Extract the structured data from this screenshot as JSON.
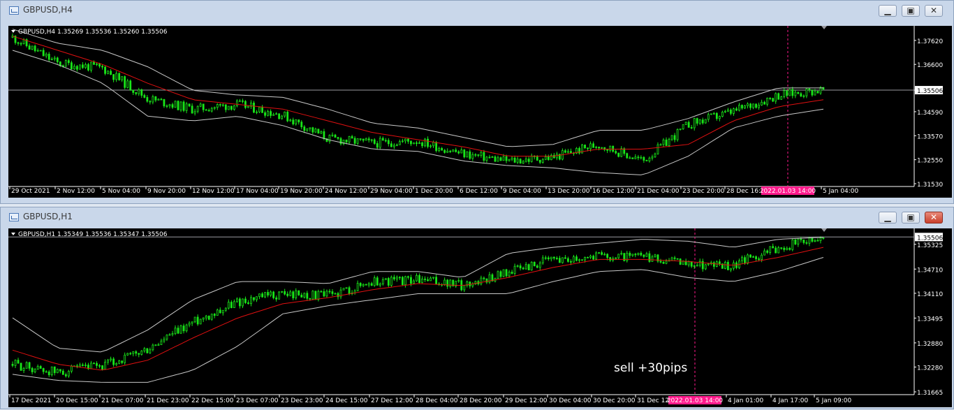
{
  "windows": [
    {
      "title": "GBPUSD,H4",
      "info": "GBPUSD,H4  1.35269 1.35536 1.35260 1.35506",
      "price_labels": [
        "1.37620",
        "1.36600",
        "1.35506",
        "1.34590",
        "1.33570",
        "1.32550",
        "1.31530"
      ],
      "current_price": "1.35506",
      "time_labels": [
        "29 Oct 2021",
        "2 Nov 12:00",
        "5 Nov 04:00",
        "9 Nov 20:00",
        "12 Nov 12:00",
        "17 Nov 04:00",
        "19 Nov 20:00",
        "24 Nov 12:00",
        "29 Nov 04:00",
        "1 Dec 20:00",
        "6 Dec 12:00",
        "9 Dec 04:00",
        "13 Dec 20:00",
        "16 Dec 12:00",
        "21 Dec 04:00",
        "23 Dec 20:00",
        "28 Dec 16:00",
        "5 Jan 04:00"
      ],
      "highlight_time": "2022.01.03 14:00",
      "close_button_style": "normal"
    },
    {
      "title": "GBPUSD,H1",
      "info": "GBPUSD,H1  1.35349 1.35536 1.35347 1.35506",
      "price_labels": [
        "1.35325",
        "1.34710",
        "1.34110",
        "1.33495",
        "1.32880",
        "1.32280",
        "1.31665"
      ],
      "current_price": "1.35506",
      "time_labels": [
        "17 Dec 2021",
        "20 Dec 15:00",
        "21 Dec 07:00",
        "21 Dec 23:00",
        "22 Dec 15:00",
        "23 Dec 07:00",
        "23 Dec 23:00",
        "24 Dec 15:00",
        "27 Dec 12:00",
        "28 Dec 04:00",
        "28 Dec 20:00",
        "29 Dec 12:00",
        "30 Dec 04:00",
        "30 Dec 20:00",
        "31 Dec 12:",
        "4 Jan 01:00",
        "4 Jan 17:00",
        "5 Jan 09:00"
      ],
      "highlight_time": "2022.01.03 14:00",
      "annotation": "sell  +30pips",
      "close_button_style": "red"
    }
  ],
  "colors": {
    "background": "#000000",
    "candle": "#19e619",
    "moving_average": "#e01010",
    "bands": "#c8c8c8",
    "highlight": "#ff1a8c",
    "grid_line": "#9a9aa0"
  },
  "chart_data": [
    {
      "type": "candlestick",
      "symbol": "GBPUSD",
      "timeframe": "H4",
      "ylim": [
        1.3153,
        1.3812
      ],
      "current_price": 1.35506,
      "last_bar": {
        "open": 1.35269,
        "high": 1.35536,
        "low": 1.3526,
        "close": 1.35506
      },
      "indicators": [
        "Moving Average",
        "Bollinger Bands"
      ],
      "x": [
        "29 Oct 2021",
        "2 Nov 12:00",
        "5 Nov 04:00",
        "9 Nov 20:00",
        "12 Nov 12:00",
        "17 Nov 04:00",
        "19 Nov 20:00",
        "24 Nov 12:00",
        "29 Nov 04:00",
        "1 Dec 20:00",
        "6 Dec 12:00",
        "9 Dec 04:00",
        "13 Dec 20:00",
        "16 Dec 12:00",
        "21 Dec 04:00",
        "23 Dec 20:00",
        "28 Dec 16:00",
        "3 Jan 14:00",
        "5 Jan 04:00"
      ],
      "close": [
        1.3775,
        1.3665,
        1.3645,
        1.3515,
        1.347,
        1.349,
        1.3445,
        1.3345,
        1.3325,
        1.3335,
        1.328,
        1.325,
        1.3265,
        1.332,
        1.325,
        1.3405,
        1.346,
        1.353,
        1.3552
      ],
      "ma": [
        1.378,
        1.372,
        1.366,
        1.358,
        1.351,
        1.349,
        1.347,
        1.342,
        1.337,
        1.334,
        1.331,
        1.327,
        1.327,
        1.33,
        1.33,
        1.332,
        1.342,
        1.348,
        1.351
      ],
      "upper_band": [
        1.381,
        1.375,
        1.372,
        1.365,
        1.355,
        1.353,
        1.352,
        1.347,
        1.341,
        1.339,
        1.335,
        1.331,
        1.332,
        1.338,
        1.338,
        1.343,
        1.35,
        1.356,
        1.356
      ],
      "lower_band": [
        1.372,
        1.366,
        1.358,
        1.344,
        1.342,
        1.344,
        1.34,
        1.334,
        1.33,
        1.329,
        1.325,
        1.323,
        1.322,
        1.32,
        1.319,
        1.327,
        1.339,
        1.344,
        1.347
      ]
    },
    {
      "type": "candlestick",
      "symbol": "GBPUSD",
      "timeframe": "H1",
      "ylim": [
        1.31665,
        1.3565
      ],
      "current_price": 1.35506,
      "last_bar": {
        "open": 1.35349,
        "high": 1.35536,
        "low": 1.35347,
        "close": 1.35506
      },
      "indicators": [
        "Moving Average",
        "Bollinger Bands"
      ],
      "annotation": "sell  +30pips",
      "x": [
        "17 Dec 2021",
        "20 Dec 15:00",
        "21 Dec 07:00",
        "21 Dec 23:00",
        "22 Dec 15:00",
        "23 Dec 07:00",
        "23 Dec 23:00",
        "24 Dec 15:00",
        "27 Dec 12:00",
        "28 Dec 04:00",
        "28 Dec 20:00",
        "29 Dec 12:00",
        "30 Dec 04:00",
        "30 Dec 20:00",
        "31 Dec 12:00",
        "3 Jan 14:00",
        "4 Jan 01:00",
        "4 Jan 17:00",
        "5 Jan 09:00"
      ],
      "close": [
        1.3235,
        1.3215,
        1.323,
        1.327,
        1.334,
        1.339,
        1.341,
        1.3405,
        1.344,
        1.3445,
        1.343,
        1.3465,
        1.3495,
        1.3505,
        1.35,
        1.3485,
        1.348,
        1.3525,
        1.355
      ],
      "ma": [
        1.327,
        1.3235,
        1.322,
        1.3245,
        1.33,
        1.335,
        1.3385,
        1.34,
        1.342,
        1.3435,
        1.343,
        1.345,
        1.3475,
        1.3495,
        1.3495,
        1.349,
        1.348,
        1.35,
        1.3525
      ],
      "upper_band": [
        1.335,
        1.3275,
        1.3265,
        1.332,
        1.3395,
        1.344,
        1.344,
        1.3435,
        1.3465,
        1.3465,
        1.345,
        1.351,
        1.3525,
        1.3535,
        1.3545,
        1.354,
        1.3525,
        1.3545,
        1.355
      ],
      "lower_band": [
        1.321,
        1.3195,
        1.319,
        1.319,
        1.322,
        1.328,
        1.336,
        1.338,
        1.3395,
        1.341,
        1.341,
        1.341,
        1.344,
        1.3465,
        1.347,
        1.345,
        1.344,
        1.3465,
        1.35
      ]
    }
  ]
}
